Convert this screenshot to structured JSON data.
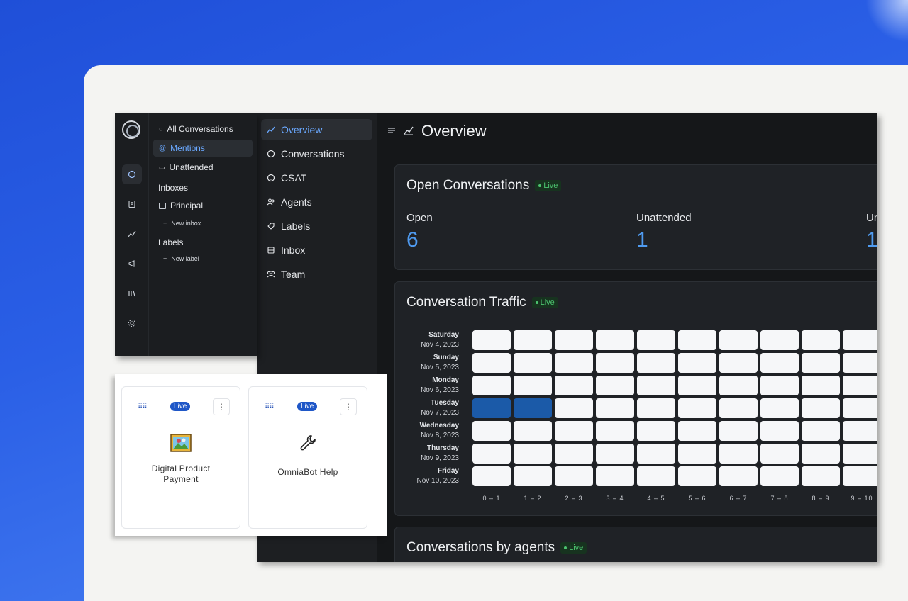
{
  "reports_nav": {
    "items": [
      {
        "label": "Overview",
        "icon": "chart-icon",
        "active": true
      },
      {
        "label": "Conversations",
        "icon": "chat-icon",
        "active": false
      },
      {
        "label": "CSAT",
        "icon": "smile-icon",
        "active": false
      },
      {
        "label": "Agents",
        "icon": "users-icon",
        "active": false
      },
      {
        "label": "Labels",
        "icon": "tag-icon",
        "active": false
      },
      {
        "label": "Inbox",
        "icon": "inbox-icon",
        "active": false
      },
      {
        "label": "Team",
        "icon": "team-icon",
        "active": false
      }
    ]
  },
  "header": {
    "title": "Overview"
  },
  "open_conversations": {
    "title": "Open Conversations",
    "live_label": "Live",
    "metrics": [
      {
        "label": "Open",
        "value": "6"
      },
      {
        "label": "Unattended",
        "value": "1"
      },
      {
        "label": "Un",
        "value": "1"
      }
    ]
  },
  "traffic": {
    "title": "Conversation Traffic",
    "live_label": "Live",
    "rows": [
      {
        "day": "Saturday",
        "date": "Nov 4, 2023"
      },
      {
        "day": "Sunday",
        "date": "Nov 5, 2023"
      },
      {
        "day": "Monday",
        "date": "Nov 6, 2023"
      },
      {
        "day": "Tuesday",
        "date": "Nov 7, 2023"
      },
      {
        "day": "Wednesday",
        "date": "Nov 8, 2023"
      },
      {
        "day": "Thursday",
        "date": "Nov 9, 2023"
      },
      {
        "day": "Friday",
        "date": "Nov 10, 2023"
      }
    ],
    "hours": [
      "0 – 1",
      "1 – 2",
      "2 – 3",
      "3 – 4",
      "4 – 5",
      "5 – 6",
      "6 – 7",
      "7 – 8",
      "8 – 9",
      "9 – 10"
    ],
    "highlighted": [
      [
        3,
        0
      ],
      [
        3,
        1
      ]
    ],
    "colors": {
      "empty": "#f6f7f9",
      "hot": "#1b5aa8"
    }
  },
  "agents_card": {
    "title": "Conversations by agents",
    "live_label": "Live"
  },
  "side_panel": {
    "items": [
      {
        "label": "All Conversations",
        "icon": "chat-icon",
        "active": false
      },
      {
        "label": "Mentions",
        "icon": "at-icon",
        "active": true
      },
      {
        "label": "Unattended",
        "icon": "inbox-icon",
        "active": false
      }
    ],
    "inboxes_heading": "Inboxes",
    "inbox": "Principal",
    "new_inbox": "New inbox",
    "labels_heading": "Labels",
    "new_label": "New label"
  },
  "widgets": [
    {
      "label_line1": "Digital Product",
      "label_line2": "Payment",
      "live": "Live",
      "icon": "picture-icon"
    },
    {
      "label_line1": "OmniaBot Help",
      "label_line2": "",
      "live": "Live",
      "icon": "wrench-icon"
    }
  ]
}
